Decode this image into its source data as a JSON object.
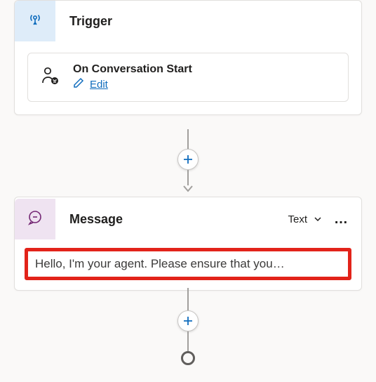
{
  "icons": {
    "trigger": "antenna-icon",
    "event": "user-speech-icon",
    "edit": "pencil-icon",
    "message": "chat-bubble-icon",
    "dropdown": "chevron-down-icon",
    "more": "more-horizontal-icon",
    "add": "plus-icon"
  },
  "colors": {
    "accent": "#0f6cbd",
    "highlight_border": "#e2231a",
    "trigger_tile_bg": "#deecf9",
    "message_tile_bg": "#efe3f1"
  },
  "trigger": {
    "title": "Trigger",
    "event_title": "On Conversation Start",
    "edit_label": "Edit"
  },
  "message": {
    "title": "Message",
    "type_label": "Text",
    "more_label": "…",
    "body_text": "Hello, I'm your agent. Please ensure that you…"
  }
}
